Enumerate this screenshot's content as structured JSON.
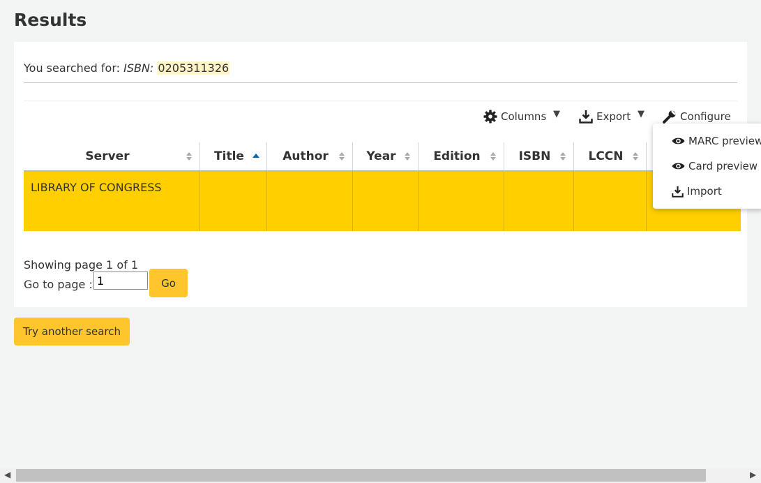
{
  "page": {
    "title": "Results"
  },
  "search": {
    "prefix": "You searched for: ",
    "index": "ISBN:",
    "term": "0205311326"
  },
  "toolbar": {
    "columns_label": "Columns",
    "export_label": "Export",
    "configure_label": "Configure"
  },
  "table": {
    "headers": [
      "Server",
      "Title",
      "Author",
      "Year",
      "Edition",
      "ISBN",
      "LCCN"
    ],
    "sorted_column": "Title",
    "rows": [
      {
        "server": "LIBRARY OF CONGRESS",
        "title": "",
        "author": "",
        "year": "",
        "edition": "",
        "isbn": "",
        "lccn": ""
      }
    ],
    "row_highlight_color": "#ffcf00"
  },
  "row_menu": {
    "items": [
      "MARC preview",
      "Card preview",
      "Import"
    ]
  },
  "pagination": {
    "showing": "Showing page 1 of 1",
    "goto_label": "Go to page :",
    "goto_value": "1",
    "go_label": "Go"
  },
  "actions": {
    "try_another": "Try another search"
  },
  "colors": {
    "button": "#fec52d",
    "highlight": "#fff4c6",
    "sort_active": "#0065b3"
  }
}
